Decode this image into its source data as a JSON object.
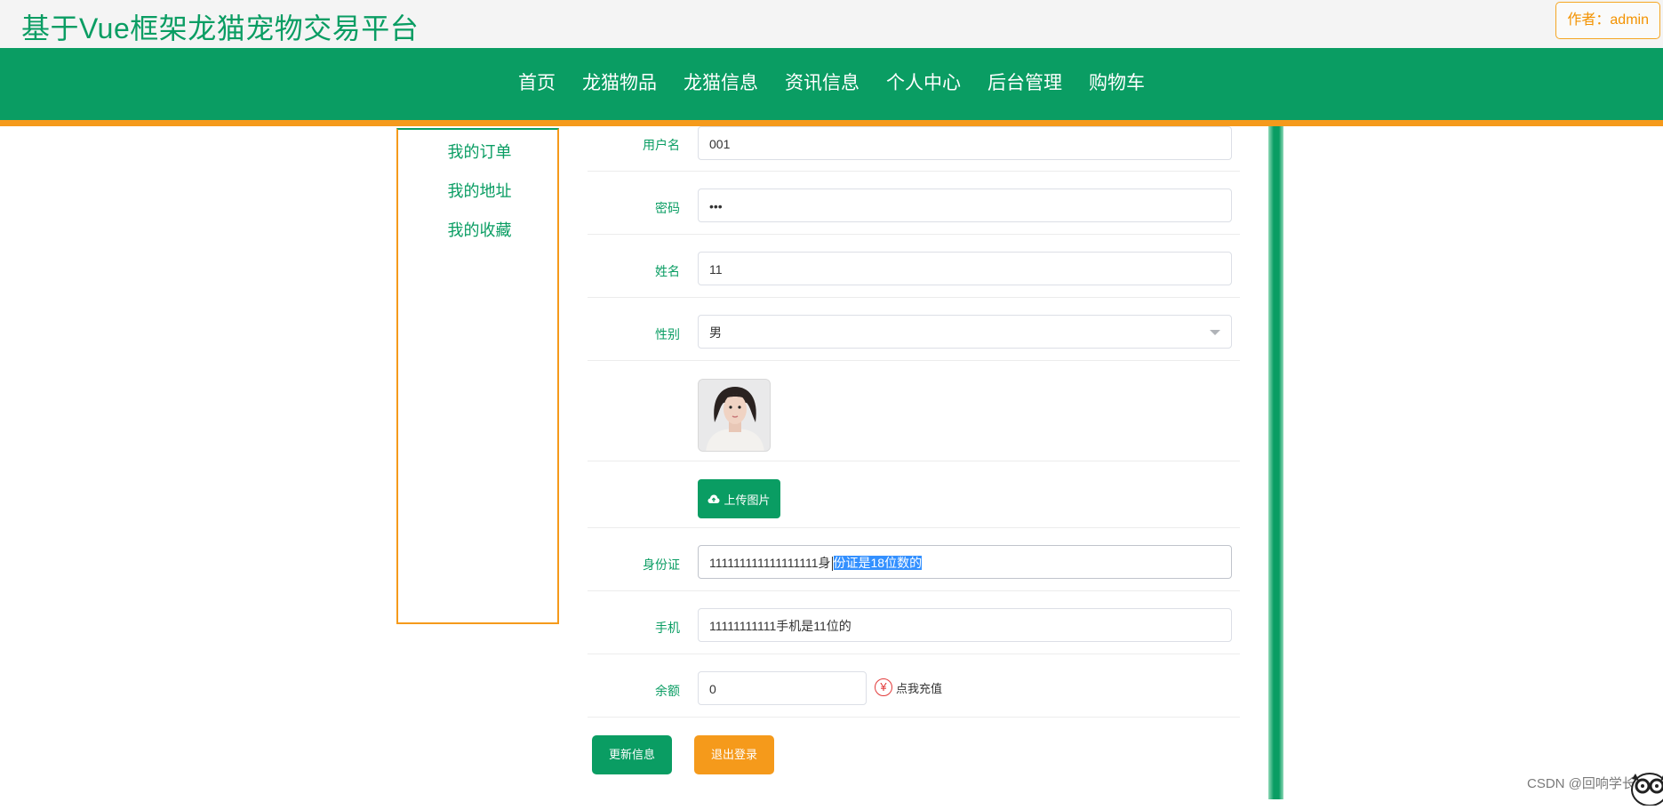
{
  "header": {
    "site_title": "基于Vue框架龙猫宠物交易平台",
    "author_badge": "作者：admin"
  },
  "nav": {
    "items": [
      "首页",
      "龙猫物品",
      "龙猫信息",
      "资讯信息",
      "个人中心",
      "后台管理",
      "购物车"
    ]
  },
  "sidebar": {
    "items": [
      "我的订单",
      "我的地址",
      "我的收藏"
    ]
  },
  "form": {
    "username": {
      "label": "用户名",
      "value": "001"
    },
    "password": {
      "label": "密码",
      "value": "•••"
    },
    "name": {
      "label": "姓名",
      "value": "11"
    },
    "gender": {
      "label": "性别",
      "value": "男"
    },
    "upload_label": "上传图片",
    "id_card": {
      "label": "身份证",
      "value_prefix": "111111111111111111身",
      "value_selected": "份证是18位数的"
    },
    "phone": {
      "label": "手机",
      "value": "11111111111手机是11位的"
    },
    "balance": {
      "label": "余额",
      "value": "0",
      "recharge_symbol": "¥",
      "recharge_label": "点我充值"
    }
  },
  "actions": {
    "update": "更新信息",
    "logout": "退出登录"
  },
  "watermark": "CSDN @回响学长",
  "colors": {
    "primary": "#0a9d63",
    "accent": "#f59a1b",
    "selection": "#3390ff"
  },
  "icons": [
    "upload-cloud-icon",
    "yen-icon",
    "select-arrow-icon",
    "mascot-icon"
  ]
}
